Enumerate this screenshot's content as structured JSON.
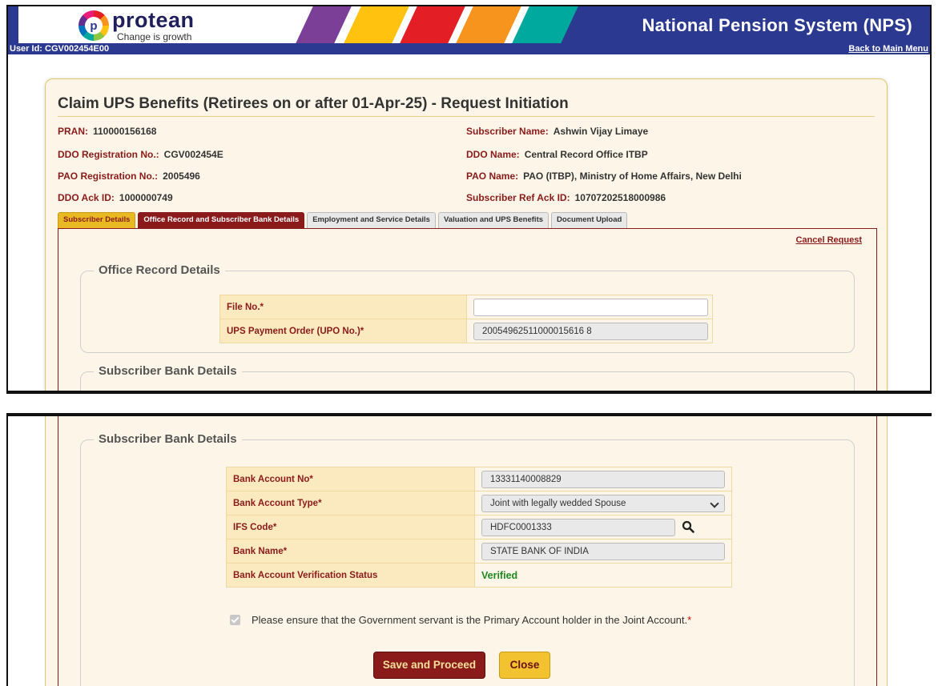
{
  "header": {
    "logo_name": "protean",
    "logo_tagline": "Change is growth",
    "logo_mark": "p",
    "title": "National Pension System (NPS)",
    "user_id": "User Id: CGV002454E00",
    "back_link": "Back to Main Menu",
    "stripe_colors": [
      "#7b3f98",
      "#ffc20e",
      "#e31e24",
      "#f7941d",
      "#00a99d"
    ]
  },
  "page": {
    "title": "Claim UPS Benefits (Retirees on or after 01-Apr-25) - Request Initiation"
  },
  "info": {
    "pran_label": "PRAN:",
    "pran": "110000156168",
    "subscriber_name_label": "Subscriber Name:",
    "subscriber_name": "Ashwin Vijay Limaye",
    "ddo_reg_label": "DDO Registration No.:",
    "ddo_reg": "CGV002454E",
    "ddo_name_label": "DDO Name:",
    "ddo_name": "Central Record Office ITBP",
    "pao_reg_label": "PAO Registration No.:",
    "pao_reg": "2005496",
    "pao_name_label": "PAO Name:",
    "pao_name": "PAO (ITBP), Ministry of Home Affairs, New Delhi",
    "ddo_ack_label": "DDO Ack ID:",
    "ddo_ack": "1000000749",
    "sub_ref_ack_label": "Subscriber Ref Ack ID:",
    "sub_ref_ack": "10707202518000986"
  },
  "tabs": [
    {
      "label": "Subscriber Details"
    },
    {
      "label": "Office Record and Subscriber Bank Details"
    },
    {
      "label": "Employment and Service Details"
    },
    {
      "label": "Valuation and UPS Benefits"
    },
    {
      "label": "Document Upload"
    }
  ],
  "cancel_request": "Cancel Request",
  "office_record": {
    "legend": "Office Record Details",
    "file_no_label": "File No.*",
    "file_no_value": "",
    "upo_label": "UPS Payment Order (UPO No.)*",
    "upo_value": "20054962511000015616 8"
  },
  "bank": {
    "legend": "Subscriber Bank Details",
    "account_no_label": "Bank Account No*",
    "account_no_value": "13331140008829",
    "account_type_label": "Bank Account Type*",
    "account_type_value": "Joint with legally wedded Spouse",
    "ifsc_label": "IFS Code*",
    "ifsc_value": "HDFC0001333",
    "bank_name_label": "Bank Name*",
    "bank_name_value": "STATE BANK OF INDIA",
    "verification_label": "Bank Account Verification Status",
    "verification_value": "Verified"
  },
  "confirm_text": "Please ensure that the Government servant is the Primary Account holder in the Joint Account.",
  "confirm_req": "*",
  "buttons": {
    "save": "Save and Proceed",
    "close": "Close"
  }
}
